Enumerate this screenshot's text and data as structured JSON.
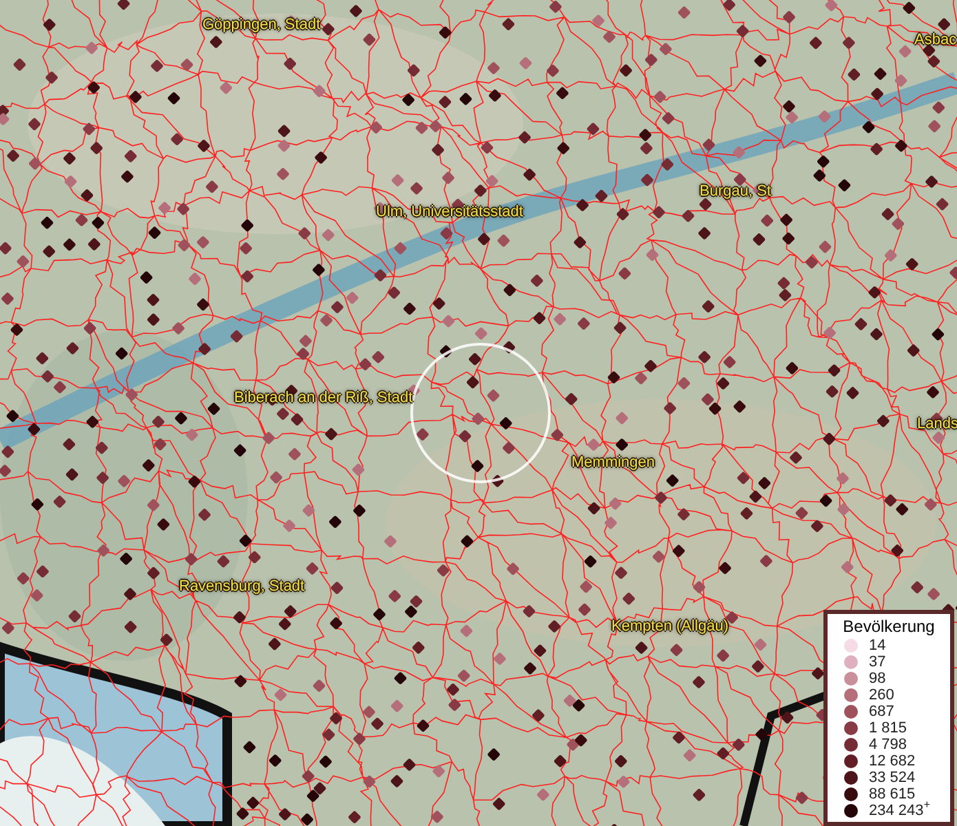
{
  "map": {
    "labels": [
      {
        "text": "Göppingen, Stadt"
      },
      {
        "text": "Asbac"
      },
      {
        "text": "Burgau, St"
      },
      {
        "text": "Ulm, Universitätsstadt"
      },
      {
        "text": "Biberach an der Riß, Stadt"
      },
      {
        "text": "Lands"
      },
      {
        "text": "Memmingen"
      },
      {
        "text": "Ravensburg, Stadt"
      },
      {
        "text": "Kempten (Allgäu)"
      }
    ]
  },
  "legend": {
    "title": "Bevölkerung",
    "items": [
      {
        "label": "14",
        "color": "#f5dbe6"
      },
      {
        "label": "37",
        "color": "#dfb0bf"
      },
      {
        "label": "98",
        "color": "#c98f9b"
      },
      {
        "label": "260",
        "color": "#b56f7b"
      },
      {
        "label": "687",
        "color": "#a0525c"
      },
      {
        "label": "1 815",
        "color": "#8a3a44"
      },
      {
        "label": "4 798",
        "color": "#762c34"
      },
      {
        "label": "12 682",
        "color": "#611e25"
      },
      {
        "label": "33 524",
        "color": "#4d1419"
      },
      {
        "label": "88 615",
        "color": "#380b0f"
      },
      {
        "label": "234 243$^{+}$",
        "color": "#240608"
      }
    ]
  }
}
